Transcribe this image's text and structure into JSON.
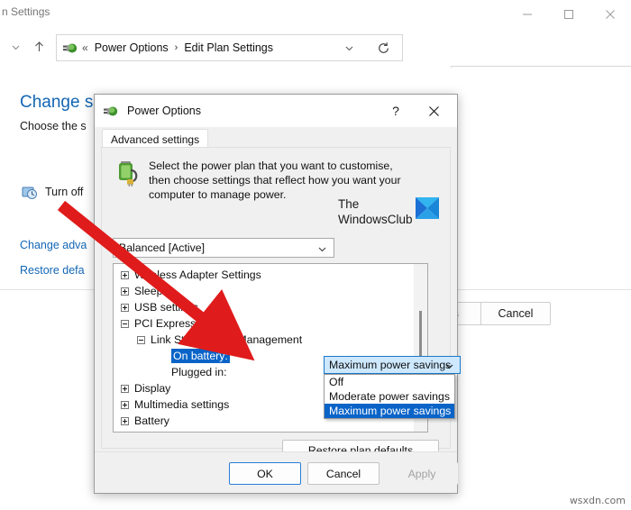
{
  "window": {
    "title": "n Settings",
    "controls": {
      "minimize": "minimize-icon",
      "maximize": "maximize-icon",
      "close": "close-icon"
    },
    "address": {
      "breadcrumb_root": "Power Options",
      "breadcrumb_sep": "›",
      "breadcrumb_current": "Edit Plan Settings",
      "overflow_chevrons": "«",
      "dropdown_icon": "chevron-down-icon",
      "refresh_icon": "refresh-icon"
    },
    "search": {
      "value": "",
      "placeholder": "",
      "icon": "search-icon"
    },
    "nav": {
      "back_forward_icon": "chevron-down-icon",
      "up_icon": "arrow-up-icon"
    }
  },
  "background_page": {
    "heading": "Change se",
    "subheading": "Choose the s",
    "row_label": "Turn off",
    "row_icon": "clock-screen-icon",
    "link_advanced": "Change adva",
    "link_restore": "Restore defa",
    "button_save": "es",
    "button_cancel": "Cancel"
  },
  "dialog": {
    "title": "Power Options",
    "title_icon": "power-plug-icon",
    "help_label": "?",
    "close_label": "✕",
    "tab": "Advanced settings",
    "description": "Select the power plan that you want to customise, then choose settings that reflect how you want your computer to manage power.",
    "description_icon": "battery-plug-icon",
    "watermark_logo": {
      "line1": "The",
      "line2": "WindowsClub",
      "mark_color": "#28a8ea"
    },
    "plan_select": {
      "value": "Balanced [Active]",
      "caret": "chevron-down-icon"
    },
    "tree": [
      {
        "label": "Wireless Adapter Settings",
        "level": 0,
        "expanded": false
      },
      {
        "label": "Sleep",
        "level": 0,
        "expanded": false
      },
      {
        "label": "USB settings",
        "level": 0,
        "expanded": false
      },
      {
        "label": "PCI Express",
        "level": 0,
        "expanded": true
      },
      {
        "label": "Link State Power Management",
        "level": 1,
        "expanded": true
      }
    ],
    "settings": [
      {
        "label": "On battery:",
        "selected": true
      },
      {
        "label": "Plugged in:",
        "selected": false
      }
    ],
    "tree_after": [
      {
        "label": "Display",
        "level": 0,
        "expanded": false
      },
      {
        "label": "Multimedia settings",
        "level": 0,
        "expanded": false
      },
      {
        "label": "Battery",
        "level": 0,
        "expanded": false
      }
    ],
    "combobox": {
      "value": "Maximum power savings",
      "caret": "chevron-down-icon",
      "open": true,
      "options": [
        "Off",
        "Moderate power savings",
        "Maximum power savings"
      ],
      "selected_option": "Maximum power savings",
      "highlight_color": "#0a64c8"
    },
    "restore_button": "Restore plan defaults",
    "footer": {
      "ok": "OK",
      "cancel": "Cancel",
      "apply": "Apply",
      "apply_disabled": true
    }
  },
  "annotation": {
    "arrow_color": "#e01b1b"
  },
  "watermark": "wsxdn.com"
}
